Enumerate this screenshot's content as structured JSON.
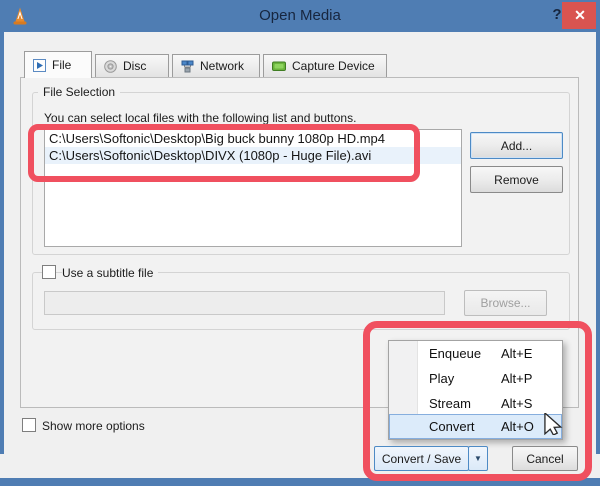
{
  "window": {
    "title": "Open Media",
    "help_label": "?",
    "close_label": "✕"
  },
  "tabs": [
    {
      "label": "File"
    },
    {
      "label": "Disc"
    },
    {
      "label": "Network"
    },
    {
      "label": "Capture Device"
    }
  ],
  "file_selection": {
    "legend": "File Selection",
    "description": "You can select local files with the following list and buttons.",
    "files": [
      "C:\\Users\\Softonic\\Desktop\\Big buck bunny 1080p HD.mp4",
      "C:\\Users\\Softonic\\Desktop\\DIVX (1080p - Huge File).avi"
    ],
    "add_label": "Add...",
    "remove_label": "Remove"
  },
  "subtitle": {
    "checkbox_label": "Use a subtitle file",
    "input_value": "",
    "browse_label": "Browse..."
  },
  "menu": {
    "items": [
      {
        "label": "Enqueue",
        "shortcut": "Alt+E"
      },
      {
        "label": "Play",
        "shortcut": "Alt+P"
      },
      {
        "label": "Stream",
        "shortcut": "Alt+S"
      },
      {
        "label": "Convert",
        "shortcut": "Alt+O"
      }
    ]
  },
  "footer": {
    "show_more_label": "Show more options",
    "convert_save_label": "Convert / Save",
    "dropdown_arrow": "▼",
    "cancel_label": "Cancel"
  },
  "colors": {
    "titlebar_blue": "#4f7db3",
    "close_red": "#d95450",
    "annotation_red": "#f0505f",
    "menu_highlight": "#dcebfa",
    "focus_border_blue": "#4d8ac5"
  }
}
